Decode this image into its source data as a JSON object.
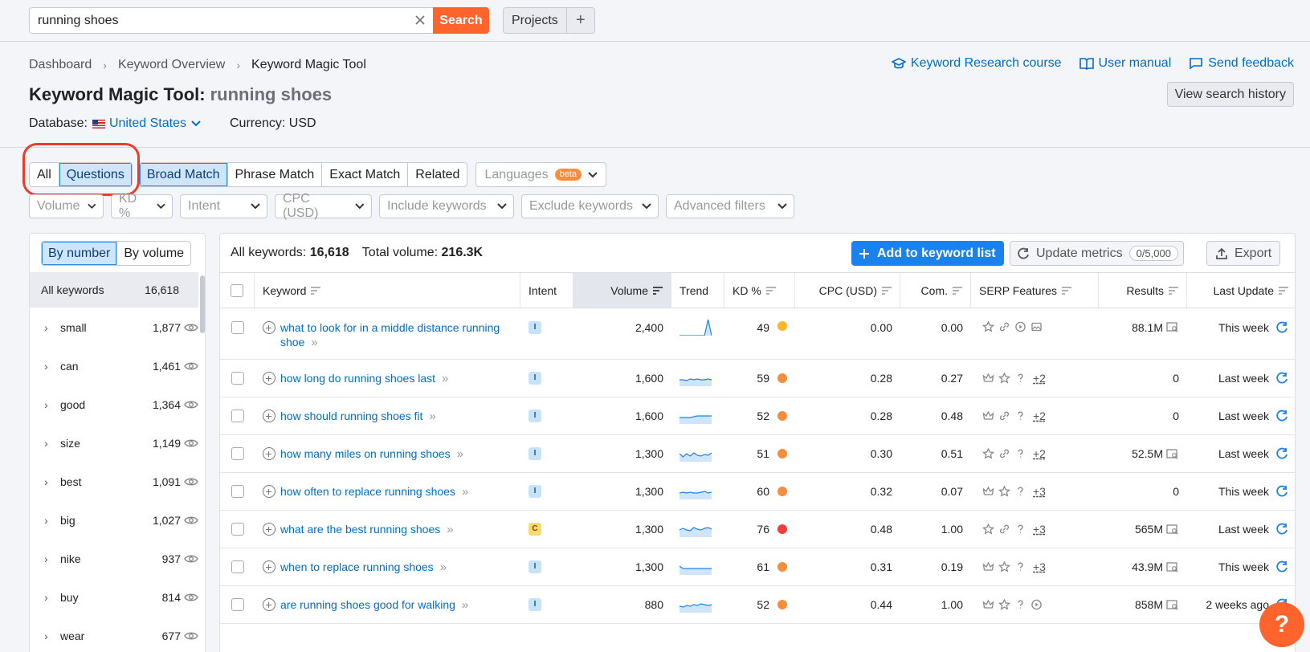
{
  "topbar": {
    "search_value": "running shoes",
    "search_button": "Search",
    "projects": "Projects",
    "plus": "+"
  },
  "breadcrumb": {
    "items": [
      "Dashboard",
      "Keyword Overview",
      "Keyword Magic Tool"
    ]
  },
  "links": {
    "course": "Keyword Research course",
    "manual": "User manual",
    "feedback": "Send feedback"
  },
  "title": {
    "tool": "Keyword Magic Tool:",
    "keyword": "running shoes"
  },
  "view_history": "View search history",
  "database": {
    "label": "Database:",
    "value": "United States",
    "currency": "Currency: USD"
  },
  "segments": {
    "scope": [
      "All",
      "Questions"
    ],
    "match": [
      "Broad Match",
      "Phrase Match",
      "Exact Match",
      "Related"
    ],
    "languages": "Languages",
    "beta": "beta"
  },
  "filters": [
    "Volume",
    "KD %",
    "Intent",
    "CPC (USD)",
    "Include keywords",
    "Exclude keywords",
    "Advanced filters"
  ],
  "sidebar": {
    "by_number": "By number",
    "by_volume": "By volume",
    "all_label": "All keywords",
    "all_count": "16,618",
    "groups": [
      {
        "name": "small",
        "count": "1,877"
      },
      {
        "name": "can",
        "count": "1,461"
      },
      {
        "name": "good",
        "count": "1,364"
      },
      {
        "name": "size",
        "count": "1,149"
      },
      {
        "name": "best",
        "count": "1,091"
      },
      {
        "name": "big",
        "count": "1,027"
      },
      {
        "name": "nike",
        "count": "937"
      },
      {
        "name": "buy",
        "count": "814"
      },
      {
        "name": "wear",
        "count": "677"
      }
    ]
  },
  "summary": {
    "all_label": "All keywords:",
    "all_value": "16,618",
    "vol_label": "Total volume:",
    "vol_value": "216.3K"
  },
  "actions": {
    "add": "Add to keyword list",
    "update": "Update metrics",
    "quota": "0/5,000",
    "export": "Export"
  },
  "columns": [
    "Keyword",
    "Intent",
    "Volume",
    "Trend",
    "KD %",
    "CPC (USD)",
    "Com.",
    "SERP Features",
    "Results",
    "Last Update"
  ],
  "rows": [
    {
      "keyword": "what to look for in a middle distance running",
      "keyword2": "shoe",
      "intent": "I",
      "volume": "2,400",
      "kd": "49",
      "kd_color": "#f7b72b",
      "cpc": "0.00",
      "com": "0.00",
      "serp": [
        "star",
        "link",
        "play",
        "image"
      ],
      "serp_more": "",
      "results": "88.1M",
      "results_icon": true,
      "update": "This week",
      "trend": [
        0,
        0,
        0,
        0,
        0,
        0,
        0,
        0,
        1,
        0
      ]
    },
    {
      "keyword": "how long do running shoes last",
      "intent": "I",
      "volume": "1,600",
      "kd": "59",
      "kd_color": "#f48d3c",
      "cpc": "0.28",
      "com": "0.27",
      "serp": [
        "crown",
        "star",
        "question"
      ],
      "serp_more": "+2",
      "results": "0",
      "results_icon": false,
      "update": "Last week",
      "trend": [
        0.4,
        0.4,
        0.35,
        0.45,
        0.4,
        0.45,
        0.4,
        0.4,
        0.45,
        0.4
      ]
    },
    {
      "keyword": "how should running shoes fit",
      "intent": "I",
      "volume": "1,600",
      "kd": "52",
      "kd_color": "#f48d3c",
      "cpc": "0.28",
      "com": "0.48",
      "serp": [
        "crown",
        "link",
        "question"
      ],
      "serp_more": "+2",
      "results": "0",
      "results_icon": false,
      "update": "Last week",
      "trend": [
        0.4,
        0.4,
        0.4,
        0.4,
        0.45,
        0.5,
        0.5,
        0.5,
        0.5,
        0.5
      ]
    },
    {
      "keyword": "how many miles on running shoes",
      "intent": "I",
      "volume": "1,300",
      "kd": "51",
      "kd_color": "#f48d3c",
      "cpc": "0.30",
      "com": "0.51",
      "serp": [
        "star",
        "link",
        "question"
      ],
      "serp_more": "+2",
      "results": "52.5M",
      "results_icon": true,
      "update": "Last week",
      "trend": [
        0.5,
        0.3,
        0.5,
        0.35,
        0.55,
        0.4,
        0.35,
        0.45,
        0.4,
        0.55
      ]
    },
    {
      "keyword": "how often to replace running shoes",
      "intent": "I",
      "volume": "1,300",
      "kd": "60",
      "kd_color": "#f48d3c",
      "cpc": "0.32",
      "com": "0.07",
      "serp": [
        "crown",
        "star",
        "question"
      ],
      "serp_more": "+3",
      "results": "0",
      "results_icon": false,
      "update": "This week",
      "trend": [
        0.4,
        0.45,
        0.4,
        0.45,
        0.4,
        0.4,
        0.45,
        0.5,
        0.4,
        0.45
      ]
    },
    {
      "keyword": "what are the best running shoes",
      "intent": "C",
      "volume": "1,300",
      "kd": "76",
      "kd_color": "#f23d3d",
      "cpc": "0.48",
      "com": "1.00",
      "serp": [
        "star",
        "link",
        "question"
      ],
      "serp_more": "+3",
      "results": "565M",
      "results_icon": true,
      "update": "Last week",
      "trend": [
        0.45,
        0.55,
        0.45,
        0.4,
        0.6,
        0.5,
        0.45,
        0.55,
        0.6,
        0.5
      ]
    },
    {
      "keyword": "when to replace running shoes",
      "intent": "I",
      "volume": "1,300",
      "kd": "61",
      "kd_color": "#f48d3c",
      "cpc": "0.31",
      "com": "0.19",
      "serp": [
        "crown",
        "star",
        "question"
      ],
      "serp_more": "+3",
      "results": "43.9M",
      "results_icon": true,
      "update": "This week",
      "trend": [
        0.55,
        0.4,
        0.4,
        0.4,
        0.4,
        0.4,
        0.4,
        0.4,
        0.4,
        0.4
      ]
    },
    {
      "keyword": "are running shoes good for walking",
      "intent": "I",
      "volume": "880",
      "kd": "52",
      "kd_color": "#f48d3c",
      "cpc": "0.44",
      "com": "1.00",
      "serp": [
        "crown",
        "star",
        "question",
        "play"
      ],
      "serp_more": "",
      "results": "858M",
      "results_icon": true,
      "update": "2 weeks ago",
      "trend": [
        0.4,
        0.35,
        0.45,
        0.4,
        0.5,
        0.45,
        0.55,
        0.5,
        0.45,
        0.5
      ]
    }
  ],
  "help": "?"
}
